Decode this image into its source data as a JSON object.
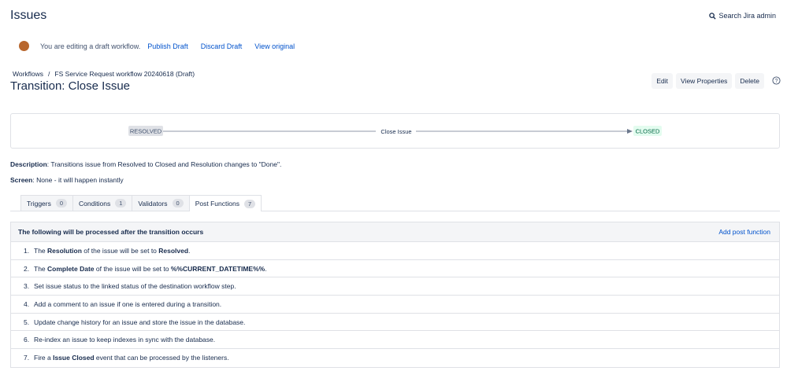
{
  "header": {
    "title": "Issues",
    "search_label": "Search Jira admin"
  },
  "draft_bar": {
    "message": "You are editing a draft workflow.",
    "links": [
      "Publish Draft",
      "Discard Draft",
      "View original"
    ]
  },
  "breadcrumb": {
    "root": "Workflows",
    "separator": "/",
    "current": "FS Service Request workflow 20240618 (Draft)"
  },
  "transition": {
    "title": "Transition: Close Issue"
  },
  "actions": {
    "edit": "Edit",
    "view_properties": "View Properties",
    "delete": "Delete"
  },
  "diagram": {
    "from": "RESOLVED",
    "transition": "Close Issue",
    "to": "CLOSED",
    "from_color": "#dfe1e6",
    "to_color": "#e3fcef"
  },
  "description": {
    "label": "Description",
    "text": ": Transitions issue from Resolved to Closed and Resolution changes to \"Done\"."
  },
  "screen": {
    "label": "Screen",
    "text": ": None - it will happen instantly"
  },
  "tabs": [
    {
      "label": "Triggers",
      "count": "0"
    },
    {
      "label": "Conditions",
      "count": "1"
    },
    {
      "label": "Validators",
      "count": "0"
    },
    {
      "label": "Post Functions",
      "count": "7"
    }
  ],
  "post_functions": {
    "header": "The following will be processed after the transition occurs",
    "add_label": "Add post function",
    "items": [
      {
        "num": "1.",
        "a": "The ",
        "b1": "Resolution",
        "c": " of the issue will be set to ",
        "b2": "Resolved",
        "d": "."
      },
      {
        "num": "2.",
        "a": "The ",
        "b1": "Complete Date",
        "c": " of the issue will be set to ",
        "b2": "%%CURRENT_DATETIME%%",
        "d": "."
      },
      {
        "num": "3.",
        "a": "Set issue status to the linked status of the destination workflow step.",
        "b1": "",
        "c": "",
        "b2": "",
        "d": ""
      },
      {
        "num": "4.",
        "a": "Add a comment to an issue if one is entered during a transition.",
        "b1": "",
        "c": "",
        "b2": "",
        "d": ""
      },
      {
        "num": "5.",
        "a": "Update change history for an issue and store the issue in the database.",
        "b1": "",
        "c": "",
        "b2": "",
        "d": ""
      },
      {
        "num": "6.",
        "a": "Re-index an issue to keep indexes in sync with the database.",
        "b1": "",
        "c": "",
        "b2": "",
        "d": ""
      },
      {
        "num": "7.",
        "a": "Fire a ",
        "b1": "Issue Closed",
        "c": " event that can be processed by the listeners.",
        "b2": "",
        "d": ""
      }
    ]
  }
}
